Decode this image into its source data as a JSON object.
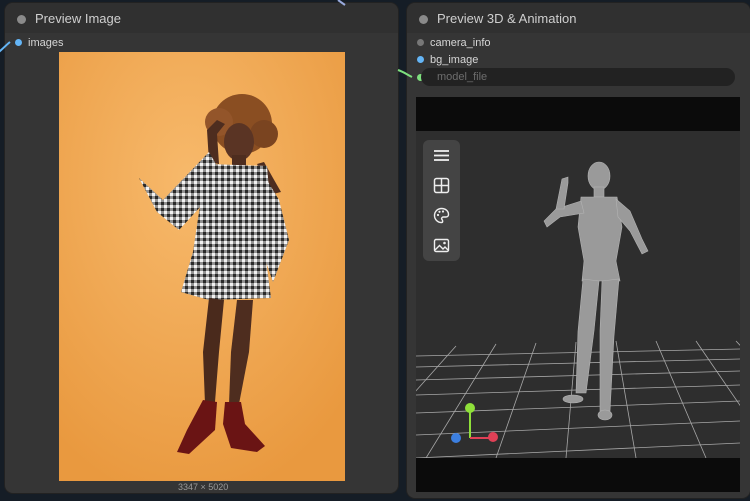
{
  "nodes": {
    "preview_image": {
      "title": "Preview Image",
      "input_label": "images",
      "image_caption": "3347 × 5020"
    },
    "preview_3d": {
      "title": "Preview 3D & Animation",
      "inputs": [
        "camera_info",
        "bg_image"
      ],
      "model_file_label": "model_file"
    }
  },
  "viewer": {
    "toolbar_icons": [
      "menu-icon",
      "grid-icon",
      "palette-icon",
      "image-icon"
    ],
    "axis_colors": {
      "x": "#e04056",
      "y": "#8fe03a",
      "z": "#3c7fe0"
    }
  },
  "colors": {
    "background": "#151d26",
    "node_body": "#353535",
    "photo_backdrop": "#f0a75a",
    "viewport": "#2e2e2e"
  }
}
